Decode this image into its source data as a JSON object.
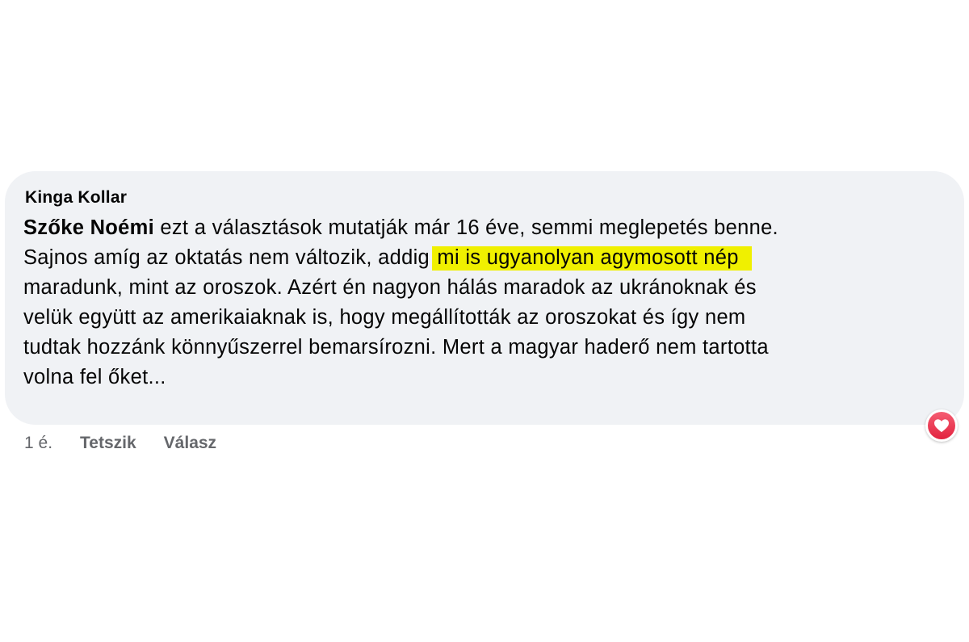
{
  "comment": {
    "author": "Kinga Kollar",
    "mention": "Szőke Noémi",
    "line1_rest": " ezt a választások mutatják már 16 éve, semmi meglepetés benne.",
    "line2_pre": "Sajnos amíg az oktatás nem változik, addig ",
    "line2_highlight": "mi is ugyanolyan agymosott nép",
    "line3": "maradunk, mint az oroszok. Azért én nagyon hálás maradok az ukránoknak és",
    "line4": "velük együtt az amerikaiaknak is, hogy megállították az oroszokat és így nem",
    "line5": "tudtak hozzánk könnyűszerrel bemarsírozni. Mert a magyar haderő nem tartotta",
    "line6": "volna fel őket...",
    "highlight_color": "#f0f000",
    "bubble_color": "#f0f2f5"
  },
  "reaction": {
    "icon": "heart-icon",
    "color": "#e2233f"
  },
  "actions": {
    "timestamp": "1 é.",
    "like_label": "Tetszik",
    "reply_label": "Válasz"
  }
}
